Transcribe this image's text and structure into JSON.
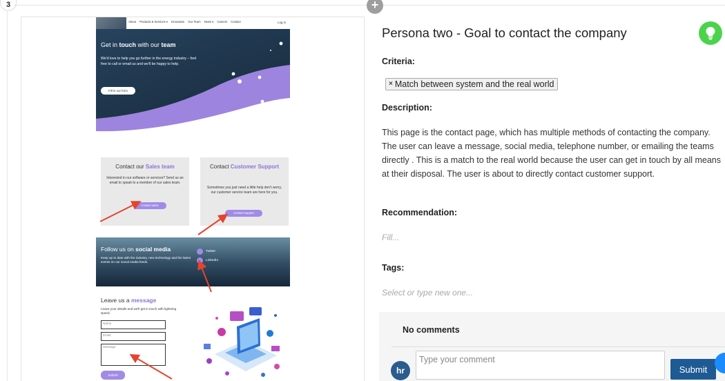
{
  "step": {
    "number": "3"
  },
  "add_button": {
    "icon": "plus-icon",
    "symbol": "+"
  },
  "screenshot": {
    "nav": {
      "items": [
        "About",
        "Products & Services ▾",
        "Innovation",
        "Our Team",
        "News ▾",
        "Careers",
        "Contact"
      ],
      "login": "Log in"
    },
    "hero": {
      "title_pre": "Get in ",
      "title_bold1": "touch",
      "title_mid": " with our ",
      "title_bold2": "team",
      "text": "We'd love to help you go further in the energy industry – feel free to call or email us and we'll be happy to help.",
      "button": "Fill in our form"
    },
    "sales_card": {
      "title_pre": "Contact our ",
      "title_accent": "Sales team",
      "text": "Interested in our software or services? Send us an email to speak to a member of our sales team.",
      "button": "Contact sales"
    },
    "support_card": {
      "title_pre": "Contact ",
      "title_accent": "Customer Support",
      "text": "Sometimes you just need a little help don't worry, our customer service team are here for you.",
      "button": "Contact support"
    },
    "social": {
      "title_pre": "Follow us on ",
      "title_bold": "social media",
      "text": "Keep up to date with the industry, new technology and the latest events on our social media feeds.",
      "twitter": "Twitter",
      "linkedin": "LinkedIn"
    },
    "message": {
      "title_pre": "Leave us a ",
      "title_accent": "message",
      "text": "Leave your details and we'll get in touch with lightning speed.",
      "name_placeholder": "Name",
      "email_placeholder": "Email",
      "message_placeholder": "Message",
      "submit": "Submit"
    }
  },
  "panel": {
    "title": "Persona two - Goal to contact the company",
    "tip_icon": "lightbulb-icon",
    "criteria_label": "Criteria:",
    "criteria_tag": "Match between system and the real world",
    "criteria_remove": "×",
    "description_label": "Description:",
    "description": "This page is the contact page, which has multiple methods of contacting the company. The user can leave a message, social media, telephone number, or emailing the teams directly . This is a match to the real world because the user can get in touch by all means at their disposal. The user is about to directly contact customer support.",
    "recommendation_label": "Recommendation:",
    "recommendation_placeholder": "Fill...",
    "tags_label": "Tags:",
    "tags_placeholder": "Select or type new one..."
  },
  "comments": {
    "heading": "No comments",
    "avatar_initials": "hr",
    "input_placeholder": "Type your comment",
    "submit": "Submit"
  },
  "colors": {
    "accent_purple": "#a08be6",
    "tip_green": "#4cd34c",
    "submit_blue": "#1e5a93",
    "avatar_blue": "#2a5c8d",
    "arrow_red": "#e5432e"
  }
}
